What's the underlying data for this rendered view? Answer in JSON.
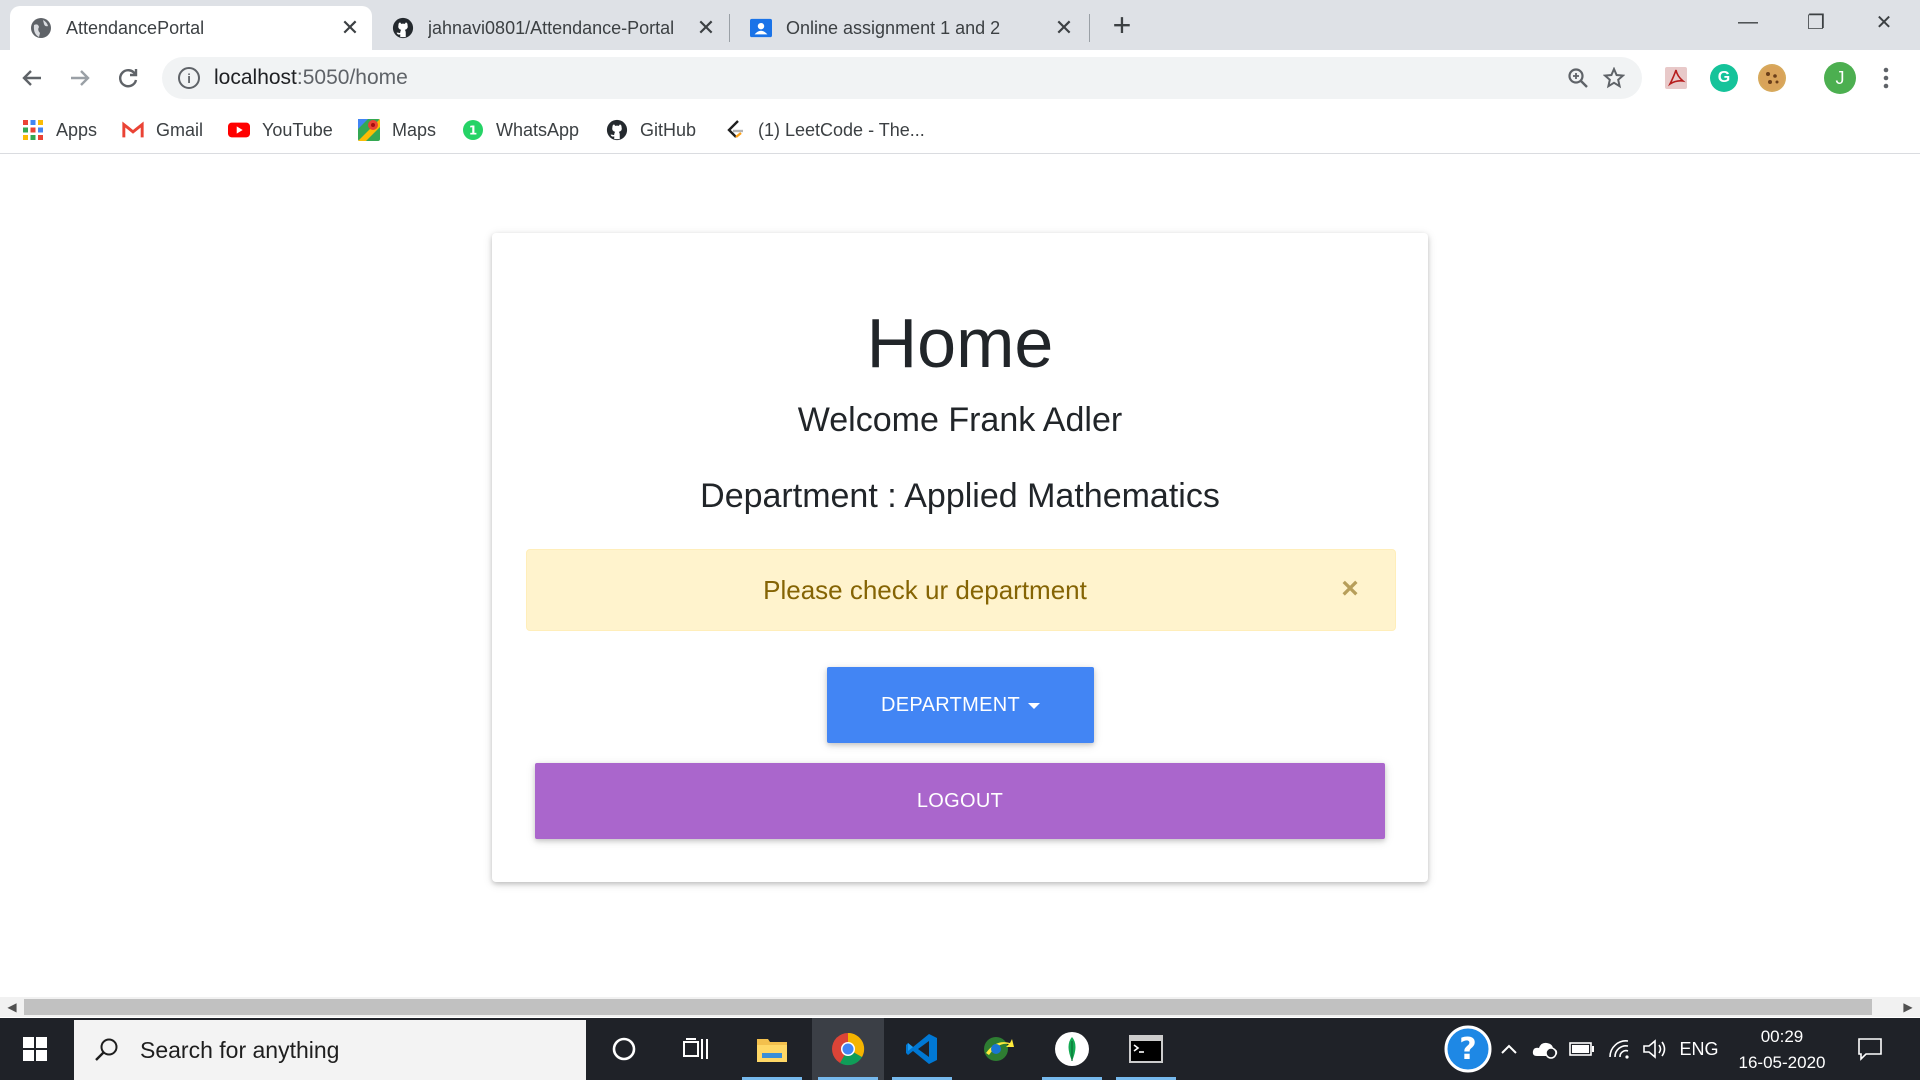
{
  "browser": {
    "tabs": [
      {
        "title": "AttendancePortal",
        "icon": "globe-icon",
        "active": true
      },
      {
        "title": "jahnavi0801/Attendance-Portal",
        "icon": "github-icon",
        "active": false
      },
      {
        "title": "Online assignment 1 and 2",
        "icon": "classroom-icon",
        "active": false
      }
    ],
    "new_tab_symbol": "+",
    "window_controls": {
      "minimize": "—",
      "restore": "❐",
      "close": "✕"
    },
    "address": {
      "host": "localhost",
      "path": ":5050/home"
    },
    "bookmarks": [
      {
        "label": "Apps",
        "icon": "apps-grid-icon"
      },
      {
        "label": "Gmail",
        "icon": "gmail-icon"
      },
      {
        "label": "YouTube",
        "icon": "youtube-icon"
      },
      {
        "label": "Maps",
        "icon": "maps-icon"
      },
      {
        "label": "WhatsApp",
        "icon": "whatsapp-icon"
      },
      {
        "label": "GitHub",
        "icon": "github-icon"
      },
      {
        "label": "(1) LeetCode - The...",
        "icon": "leetcode-icon"
      }
    ],
    "profile_initial": "J",
    "extensions": [
      "pdf-extension-icon",
      "grammarly-icon",
      "cookie-icon"
    ]
  },
  "page": {
    "title": "Home",
    "welcome": "Welcome Frank Adler",
    "department_line": "Department : Applied Mathematics",
    "alert": {
      "message": "Please check ur department",
      "close_symbol": "×"
    },
    "department_button": "Department",
    "logout_button": "Logout"
  },
  "taskbar": {
    "search_placeholder": "Search for anything",
    "apps": [
      "cortana-icon",
      "task-view-icon",
      "file-explorer-icon",
      "chrome-icon",
      "vscode-icon",
      "network-app-icon",
      "mongodb-icon",
      "terminal-icon"
    ],
    "tray": {
      "language": "ENG",
      "time": "00:29",
      "date": "16-05-2020"
    }
  },
  "colors": {
    "primary_button": "#4285f4",
    "logout_button": "#aa66cc",
    "alert_background": "#fff3cd",
    "alert_text": "#856404",
    "taskbar": "#1f2228"
  }
}
